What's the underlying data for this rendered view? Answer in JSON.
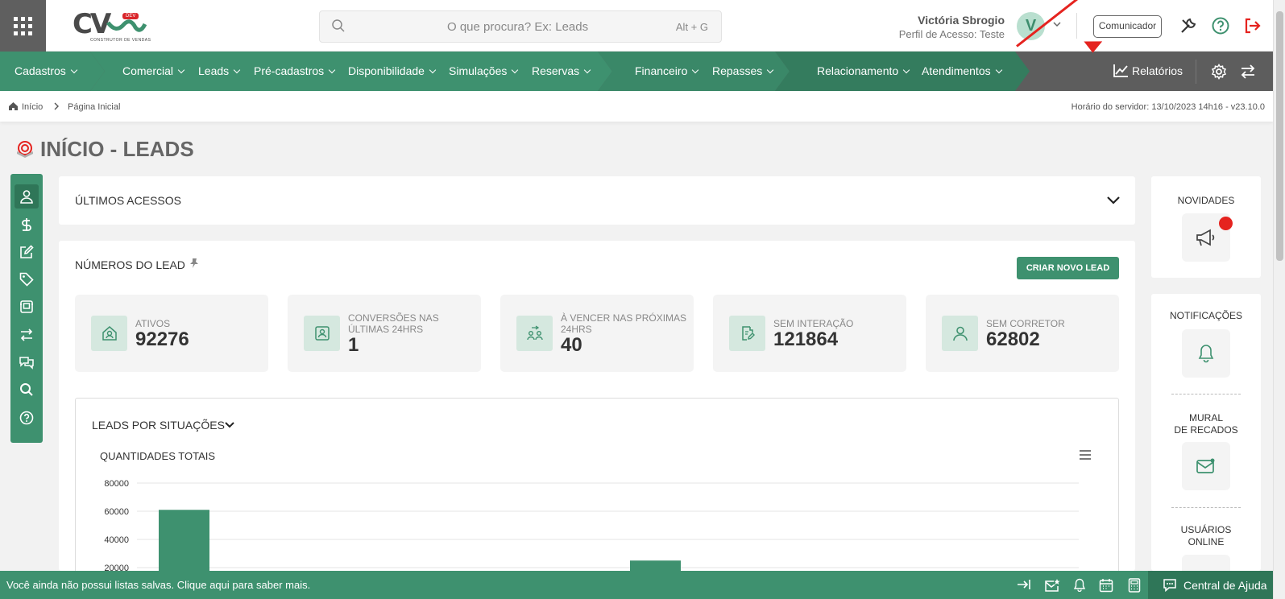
{
  "header": {
    "logo_text": "CV",
    "logo_badge": "DEV",
    "logo_subtitle": "CONSTRUTOR DE VENDAS",
    "search_placeholder": "O que procura? Ex: Leads",
    "search_shortcut": "Alt + G",
    "user_name": "Victória Sbrogio",
    "user_profile": "Perfil de Acesso: Teste",
    "avatar_letter": "V",
    "comunicador_label": "Comunicador"
  },
  "nav": {
    "groups": [
      {
        "items": [
          "Cadastros"
        ]
      },
      {
        "items": [
          "Comercial",
          "Leads",
          "Pré-cadastros",
          "Disponibilidade",
          "Simulações",
          "Reservas"
        ]
      },
      {
        "items": [
          "Financeiro",
          "Repasses"
        ]
      },
      {
        "items": [
          "Relacionamento",
          "Atendimentos"
        ]
      }
    ],
    "reports_label": "Relatórios"
  },
  "breadcrumb": {
    "home": "Início",
    "current": "Página Inicial",
    "server_time": "Horário do servidor: 13/10/2023 14h16 - v23.10.0"
  },
  "page": {
    "title": "INÍCIO - LEADS"
  },
  "ultimos_acessos": {
    "title": "ÚLTIMOS ACESSOS"
  },
  "numeros": {
    "title": "NÚMEROS DO LEAD",
    "create_button": "CRIAR NOVO LEAD",
    "stats": [
      {
        "label": "ATIVOS",
        "value": "92276",
        "icon": "home-user-icon"
      },
      {
        "label": "CONVERSÕES NAS ÚLTIMAS 24hrs",
        "value": "1",
        "icon": "user-badge-icon"
      },
      {
        "label": "À VENCER NAS PRÓXIMAS 24hrs",
        "value": "40",
        "icon": "users-exchange-icon"
      },
      {
        "label": "SEM INTERAÇÃO",
        "value": "121864",
        "icon": "document-edit-icon"
      },
      {
        "label": "SEM CORRETOR",
        "value": "62802",
        "icon": "user-icon"
      }
    ]
  },
  "situacoes": {
    "title": "LEADS POR SITUAÇÕES",
    "chart_title": "QUANTIDADES TOTAIS"
  },
  "chart_data": {
    "type": "bar",
    "title": "QUANTIDADES TOTAIS",
    "y_ticks": [
      "80000",
      "60000",
      "40000",
      "20000"
    ],
    "ylim": [
      0,
      80000
    ],
    "values": [
      61000,
      25000
    ],
    "grid": true
  },
  "right_panel": {
    "novidades": "NOVIDADES",
    "notificacoes": "NOTIFICAÇÕES",
    "mural_line1": "MURAL",
    "mural_line2": "DE RECADOS",
    "usuarios_line1": "USUÁRIOS",
    "usuarios_line2": "ONLINE"
  },
  "footer": {
    "message": "Você ainda não possui listas salvas. Clique aqui para saber mais.",
    "help_label": "Central de Ajuda"
  },
  "colors": {
    "primary_green": "#3e916f",
    "dark_green": "#2f7658",
    "nav_gray": "#5d5d5d",
    "alert_red": "#e5231f"
  }
}
